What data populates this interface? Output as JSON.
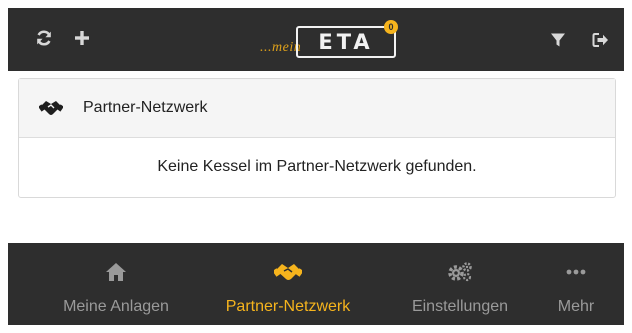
{
  "colors": {
    "bar_bg": "#2e2e2e",
    "accent": "#f6b41d",
    "inactive": "#9a9a9a",
    "icon_light": "#d8d8d8"
  },
  "topbar": {
    "left_icons": [
      "refresh-icon",
      "plus-icon"
    ],
    "right_icons": [
      "filter-icon",
      "logout-icon"
    ],
    "logo": {
      "prefix": "...mein",
      "wordmark": "ETA",
      "badge": "0"
    }
  },
  "panel": {
    "icon": "handshake-icon",
    "title": "Partner-Netzwerk",
    "message": "Keine Kessel im Partner-Netzwerk gefunden."
  },
  "bottom_nav": {
    "items": [
      {
        "label": "Meine Anlagen",
        "icon": "home-icon",
        "active": false
      },
      {
        "label": "Partner-Netzwerk",
        "icon": "handshake-icon",
        "active": true
      },
      {
        "label": "Einstellungen",
        "icon": "gears-icon",
        "active": false
      },
      {
        "label": "Mehr",
        "icon": "more-icon",
        "active": false
      }
    ]
  }
}
